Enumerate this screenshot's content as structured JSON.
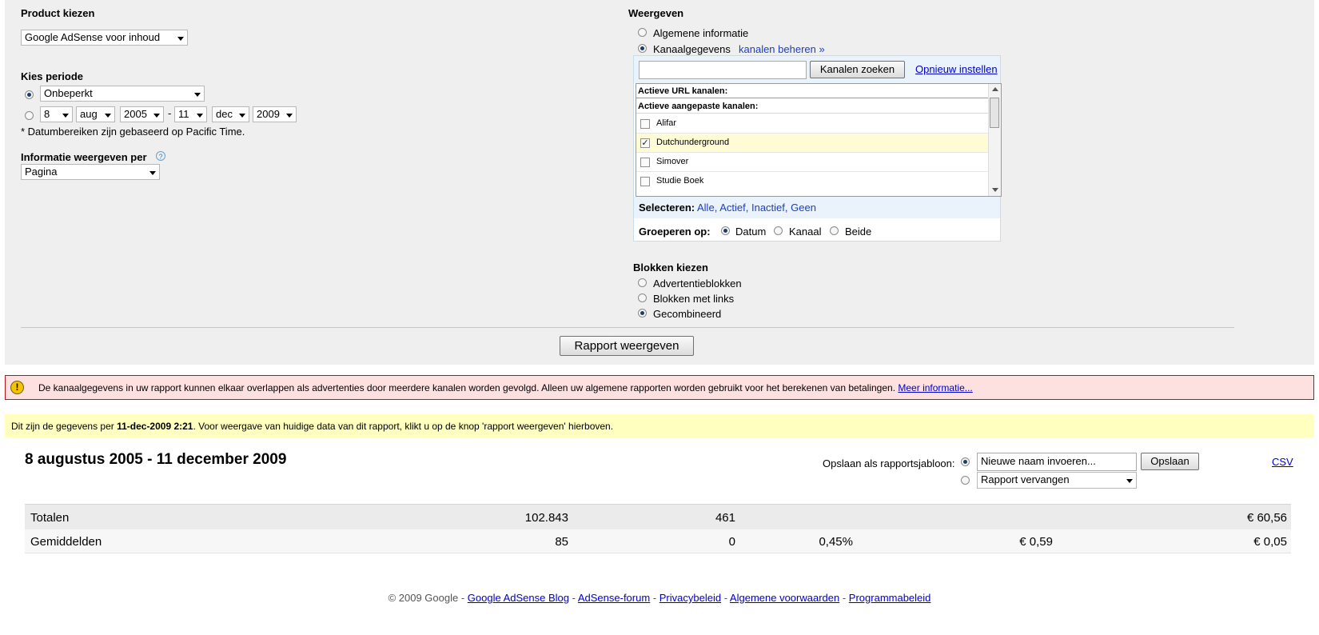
{
  "product": {
    "heading": "Product kiezen",
    "selected": "Google AdSense voor inhoud"
  },
  "period": {
    "heading": "Kies periode",
    "preset": "Onbeperkt",
    "from_day": "8",
    "from_month": "aug",
    "from_year": "2005",
    "separator": "-",
    "to_day": "11",
    "to_month": "dec",
    "to_year": "2009",
    "note": "* Datumbereiken zijn gebaseerd op Pacific Time."
  },
  "info_per": {
    "heading": "Informatie weergeven per",
    "help": "?",
    "selected": "Pagina"
  },
  "display": {
    "heading": "Weergeven",
    "opt_general": "Algemene informatie",
    "opt_channel": "Kanaalgegevens",
    "manage_link": "kanalen beheren »",
    "search_value": "",
    "search_button": "Kanalen zoeken",
    "reset_link": "Opnieuw instellen",
    "list": {
      "header_url": "Actieve URL kanalen:",
      "header_custom": "Actieve aangepaste kanalen:",
      "items": [
        {
          "label": "Alifar",
          "checked": false
        },
        {
          "label": "Dutchunderground",
          "checked": true
        },
        {
          "label": "Simover",
          "checked": false
        },
        {
          "label": "Studie Boek",
          "checked": false
        }
      ]
    },
    "select_label": "Selecteren:",
    "select_all": "Alle",
    "select_active": "Actief",
    "select_inactive": "Inactief",
    "select_none": "Geen",
    "comma": ",",
    "group_label": "Groeperen op:",
    "group_date": "Datum",
    "group_channel": "Kanaal",
    "group_both": "Beide"
  },
  "blocks": {
    "heading": "Blokken kiezen",
    "opt_ads": "Advertentieblokken",
    "opt_links": "Blokken met links",
    "opt_combined": "Gecombineerd"
  },
  "report_button": "Rapport weergeven",
  "warning": {
    "icon": "exclamation-icon",
    "text": "De kanaalgegevens in uw rapport kunnen elkaar overlappen als advertenties door meerdere kanalen worden gevolgd. Alleen uw algemene rapporten worden gebruikt voor het berekenen van betalingen.",
    "link": "Meer informatie..."
  },
  "notice": {
    "prefix": "Dit zijn de gegevens per ",
    "date": "11-dec-2009 2:21",
    "suffix": ". Voor weergave van huidige data van dit rapport, klikt u op de knop 'rapport weergeven' hierboven."
  },
  "report": {
    "date_range": "8 augustus 2005 - 11 december 2009",
    "save_label": "Opslaan als rapportsjabloon:",
    "name_placeholder": "Nieuwe naam invoeren...",
    "save_button": "Opslaan",
    "replace_select": "Rapport vervangen",
    "csv": "CSV"
  },
  "summary": {
    "totals": {
      "label": "Totalen",
      "c1": "102.843",
      "c2": "461",
      "c3": "",
      "c4": "",
      "c5": "€ 60,56"
    },
    "averages": {
      "label": "Gemiddelden",
      "c1": "85",
      "c2": "0",
      "c3": "0,45%",
      "c4": "€ 0,59",
      "c5": "€ 0,05"
    }
  },
  "footer": {
    "copyright": "© 2009 Google",
    "sep": " - ",
    "links": [
      "Google AdSense Blog",
      "AdSense-forum",
      "Privacybeleid",
      "Algemene voorwaarden",
      "Programmabeleid"
    ]
  },
  "colors": {
    "panel": "#efefef",
    "warning_bg": "#fde0e0",
    "warning_border": "#b01818",
    "notice_bg": "#ffffc0",
    "link": "#0000cc"
  }
}
